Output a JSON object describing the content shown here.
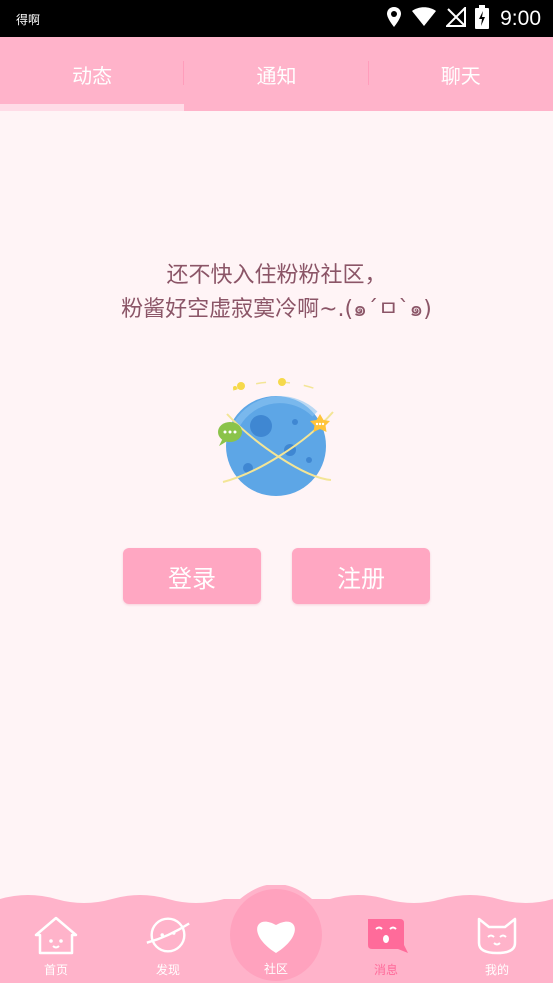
{
  "status_bar": {
    "carrier": "得啊",
    "time": "9:00"
  },
  "tabs": [
    {
      "label": "动态"
    },
    {
      "label": "通知"
    },
    {
      "label": "聊天"
    }
  ],
  "empty_state": {
    "line1": "还不快入住粉粉社区，",
    "line2": "粉酱好空虚寂寞冷啊~.(๑´ㅁ`๑)"
  },
  "actions": {
    "login": "登录",
    "register": "注册"
  },
  "bottom_nav": [
    {
      "label": "首页",
      "icon": "house-icon"
    },
    {
      "label": "发现",
      "icon": "planet-face-icon"
    },
    {
      "label": "社区",
      "icon": "heart-icon"
    },
    {
      "label": "消息",
      "icon": "message-face-icon"
    },
    {
      "label": "我的",
      "icon": "cat-face-icon"
    }
  ],
  "colors": {
    "accent": "#FFB3CA",
    "button": "#FFA7C2",
    "active_label": "#FF6B9A",
    "background": "#FFF4F6",
    "text": "#8B5567"
  }
}
